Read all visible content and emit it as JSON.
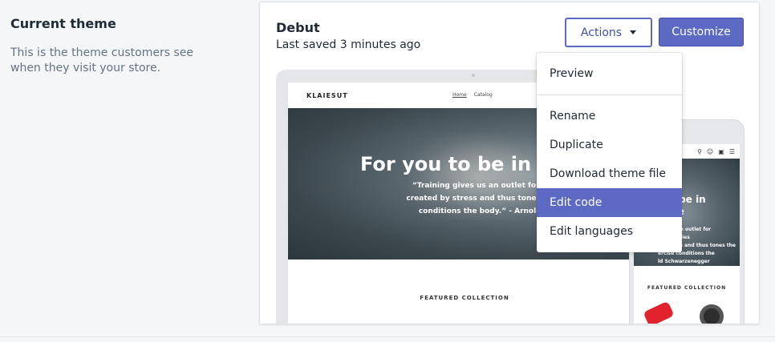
{
  "section": {
    "title": "Current theme",
    "description": "This is the theme customers see when they visit your store."
  },
  "theme": {
    "name": "Debut",
    "last_saved": "Last saved 3 minutes ago"
  },
  "buttons": {
    "actions_label": "Actions",
    "customize_label": "Customize"
  },
  "colors": {
    "primary": "#5c6ac4",
    "text": "#212b36",
    "subdued": "#637381",
    "background": "#f4f6f8"
  },
  "preview": {
    "logo": "KLAIESUT",
    "nav": [
      "Home",
      "Catalog"
    ],
    "hero_title": "For you to be in sh",
    "hero_quote_lines": [
      "“Training gives us an outlet for suppressed",
      "created by stress and thus tones the spirit jus",
      "conditions the body.”  - Arnold Schwarze"
    ],
    "featured": "FEATURED COLLECTION",
    "mobile_title_lines": [
      "to be in",
      "ape"
    ],
    "mobile_quote_lines": [
      "ves us an outlet for",
      "ed energies",
      "by stress and thus tones the",
      "ercise conditions the",
      "ld Schwarzenegger"
    ],
    "mobile_featured": "FEATURED COLLECTION"
  },
  "actions_menu": {
    "items": [
      "Preview",
      "Rename",
      "Duplicate",
      "Download theme file",
      "Edit code",
      "Edit languages"
    ],
    "selected": "Edit code"
  }
}
